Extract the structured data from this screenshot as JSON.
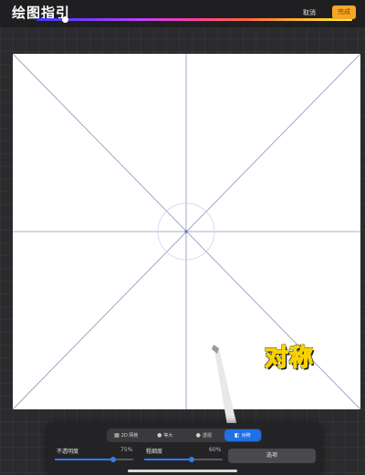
{
  "header": {
    "title": "绘图指引",
    "cancel_label": "取消",
    "done_label": "完成"
  },
  "canvas": {
    "overlay_label": "对称"
  },
  "panel": {
    "modes": [
      {
        "label": "2D 网格",
        "icon": "grid-icon"
      },
      {
        "label": "等大",
        "icon": "isometric-icon"
      },
      {
        "label": "透视",
        "icon": "perspective-icon"
      },
      {
        "label": "对称",
        "icon": "symmetry-icon",
        "active": true
      }
    ],
    "opacity": {
      "label": "不透明度",
      "value_text": "75%",
      "value": 0.75
    },
    "thickness": {
      "label": "粗细度",
      "value_text": "60%",
      "value": 0.6
    },
    "options_label": "选项"
  },
  "colors": {
    "accent": "#1f6fe5",
    "done": "#f5a623",
    "guide_line": "#8c92b8",
    "overlay_text": "#e8312a"
  }
}
